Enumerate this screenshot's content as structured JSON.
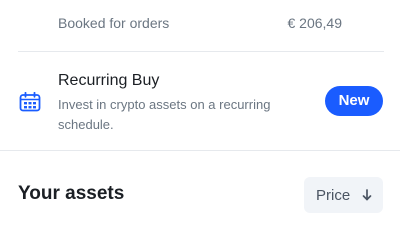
{
  "booked": {
    "label": "Booked for orders",
    "value": "€ 206,49"
  },
  "recurring": {
    "icon": "calendar-icon",
    "title": "Recurring Buy",
    "description": "Invest in crypto assets on a recurring schedule.",
    "badge": "New"
  },
  "assets": {
    "title": "Your assets",
    "sort_label": "Price",
    "sort_icon": "arrow-down-icon"
  },
  "colors": {
    "accent": "#1a5cff",
    "muted_text": "#6b7682",
    "divider": "#e6e9ed",
    "sort_bg": "#f1f4f8"
  }
}
